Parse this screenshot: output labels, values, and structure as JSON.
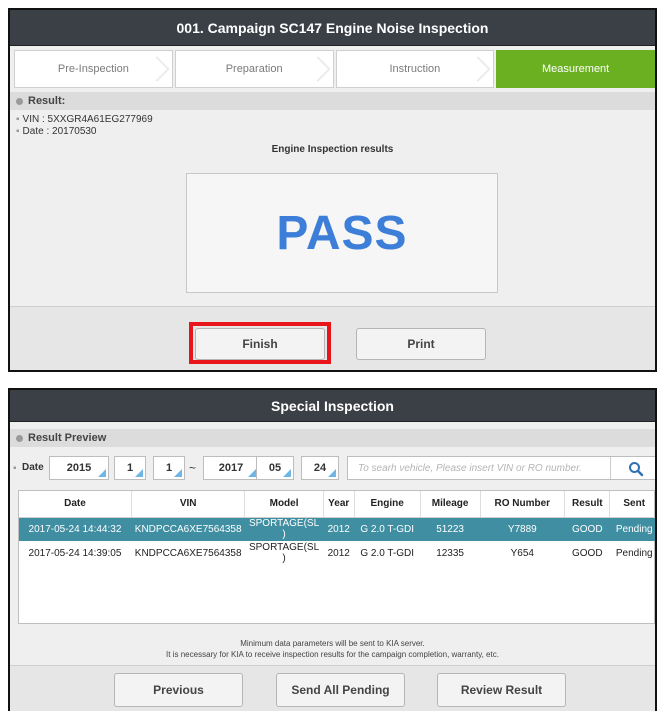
{
  "top": {
    "title": "001. Campaign SC147 Engine Noise Inspection",
    "steps": [
      "Pre-Inspection",
      "Preparation",
      "Instruction",
      "Measurement"
    ],
    "active_step": "Measurement",
    "result_label": "Result:",
    "vin_line": "VIN : 5XXGR4A61EG277969",
    "date_line": "Date : 20170530",
    "inspection_title": "Engine Inspection results",
    "pass_text": "PASS",
    "finish_label": "Finish",
    "print_label": "Print",
    "colors": {
      "active_step": "#6ab021",
      "pass": "#3d7ed8",
      "highlight": "#e8151b"
    }
  },
  "bottom": {
    "title": "Special Inspection",
    "section_label": "Result Preview",
    "date_label": "Date",
    "from": {
      "year": "2015",
      "month": "1",
      "day": "1"
    },
    "separator": "~",
    "to": {
      "year": "2017",
      "month": "05",
      "day": "24"
    },
    "search_placeholder": "To searh vehicle, Please insert VIN or RO number.",
    "search_icon": "search-icon",
    "columns": [
      "Date",
      "VIN",
      "Model",
      "Year",
      "Engine",
      "Mileage",
      "RO Number",
      "Result",
      "Sent"
    ],
    "rows": [
      {
        "date": "2017-05-24 14:44:32",
        "vin": "KNDPCCA6XE7564358",
        "model_1": "SPORTAGE(SL",
        "model_2": ")",
        "year": "2012",
        "engine": "G 2.0 T-GDI",
        "mileage": "51223",
        "ro": "Y7889",
        "result": "GOOD",
        "sent": "Pending",
        "selected": true
      },
      {
        "date": "2017-05-24 14:39:05",
        "vin": "KNDPCCA6XE7564358",
        "model_1": "SPORTAGE(SL",
        "model_2": ")",
        "year": "2012",
        "engine": "G 2.0 T-GDI",
        "mileage": "12335",
        "ro": "Y654",
        "result": "GOOD",
        "sent": "Pending",
        "selected": false
      }
    ],
    "note_line1": "Minimum data parameters will be sent to KIA server.",
    "note_line2": "It is necessary for KIA to receive inspection results for the campaign completion, warranty, etc.",
    "previous_label": "Previous",
    "send_all_label": "Send All Pending",
    "review_label": "Review Result",
    "colors": {
      "selected_row": "#3f8ea2",
      "dropdown_triangle": "#6fb6e6"
    }
  }
}
